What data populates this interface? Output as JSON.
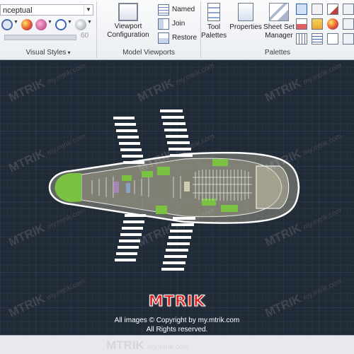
{
  "ribbon": {
    "visual_styles": {
      "current_style": "nceptual",
      "slider_value": "60",
      "title": "Visual Styles"
    },
    "model_viewports": {
      "viewport_config_line1": "Viewport",
      "viewport_config_line2": "Configuration",
      "named": "Named",
      "join": "Join",
      "restore": "Restore",
      "title": "Model Viewports"
    },
    "palettes": {
      "tool_palettes_line1": "Tool",
      "tool_palettes_line2": "Palettes",
      "properties": "Properties",
      "sheet_set_line1": "Sheet Set",
      "sheet_set_line2": "Manager",
      "title": "Palettes"
    }
  },
  "watermark": {
    "brand": "MTRIK",
    "site": "my.mtrik.com"
  },
  "footer": {
    "logo": "MTRIK",
    "copyright": "All images © Copyright by my.mtrik.com",
    "rights": "All Rights reserved."
  },
  "colors": {
    "canvas_bg": "#212a37",
    "outline": "#ffffff",
    "green_fill": "#7cc242",
    "logo_red": "#d8231e"
  }
}
